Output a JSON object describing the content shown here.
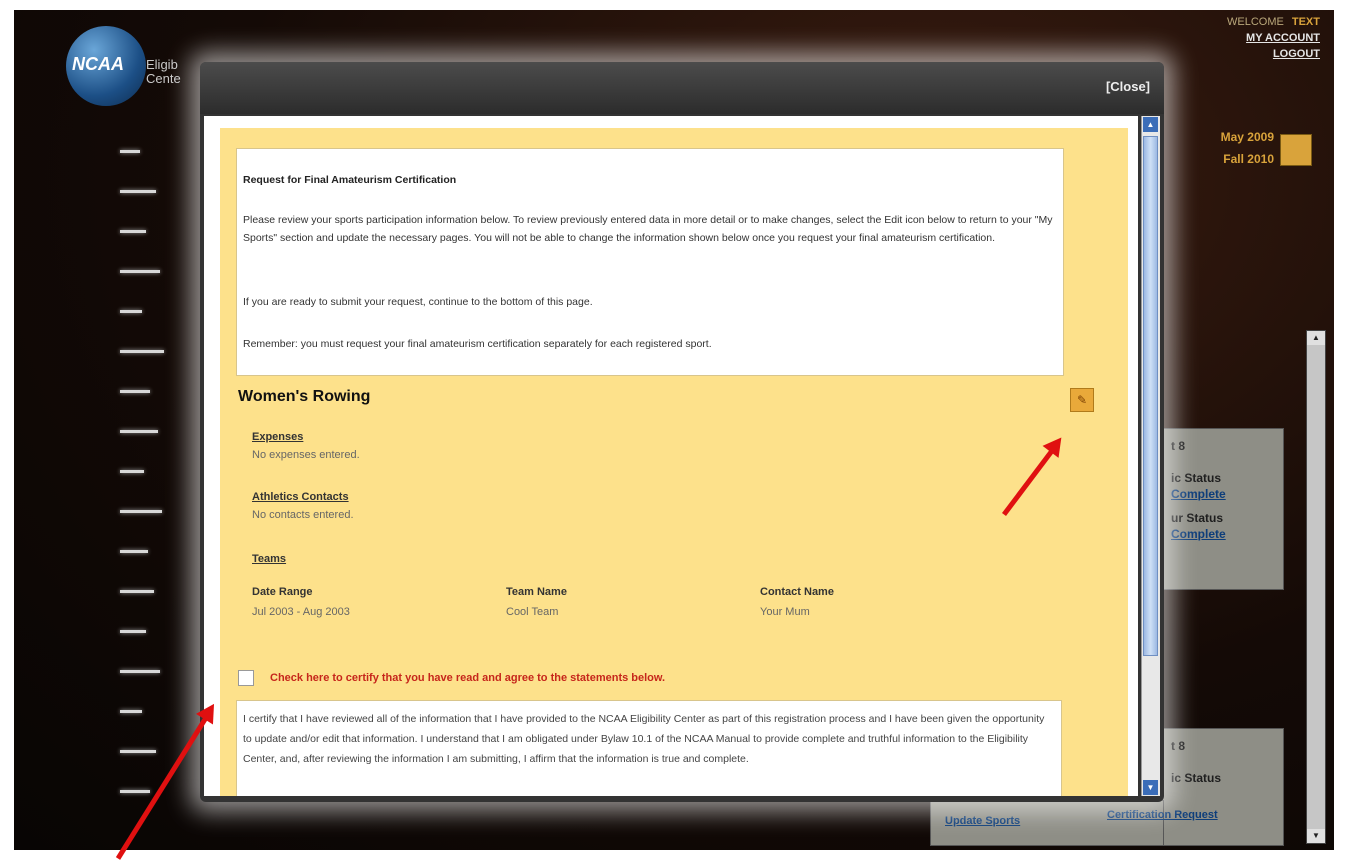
{
  "header": {
    "welcome": "WELCOME",
    "user": "TEXT",
    "my_account": "MY ACCOUNT",
    "logout": "LOGOUT",
    "logo": "NCAA",
    "logo_side_1": "Eligib",
    "logo_side_2": "Cente"
  },
  "dates": [
    "May 2009",
    "Fall 2010"
  ],
  "background_panels": {
    "panel1_title": "t 8",
    "panel1_line1": "ic Status",
    "panel1_link1": "Complete",
    "panel1_line2": "ur Status",
    "panel1_link2": "Complete",
    "panel2_title": "t 8",
    "panel2_line1": "ic Status",
    "footer_link1": "Update Sports",
    "footer_link2": "Certification Request"
  },
  "modal": {
    "close_label": "[Close]",
    "intro_title": "Request for Final Amateurism Certification",
    "intro_p1": "Please review your sports participation information below.  To review previously entered data in more detail or to make changes, select the Edit icon below to return to your \"My Sports\" section and update the necessary pages.  You will not be able to change the information shown below once you request your final amateurism certification.",
    "intro_p2": "If you are ready to submit your request, continue to the bottom of this page.",
    "intro_p3": "Remember: you must request your final amateurism certification separately for each registered sport.",
    "sport_title": "Women's Rowing",
    "expenses_label": "Expenses",
    "expenses_text": "No expenses entered.",
    "contacts_label": "Athletics Contacts",
    "contacts_text": "No contacts entered.",
    "teams_label": "Teams",
    "teams_columns": [
      "Date Range",
      "Team Name",
      "Contact Name"
    ],
    "teams_rows": [
      [
        "Jul 2003 - Aug 2003",
        "Cool Team",
        "Your Mum"
      ]
    ],
    "certify_label": "Check here to certify that you have read and agree to the statements below.",
    "statement_text": "I certify that I have reviewed all of the information that I have provided to the NCAA Eligibility Center as part of this registration process and I have been given the opportunity to update and/or edit that information.  I understand that I am obligated under Bylaw 10.1 of the NCAA Manual to provide complete and truthful information to the Eligibility Center, and, after reviewing the information I am submitting, I affirm that the information is true and complete."
  },
  "colors": {
    "content_bg": "#fde18b",
    "accent": "#d9a33b",
    "warning": "#c6261b",
    "arrow": "#e01010"
  }
}
